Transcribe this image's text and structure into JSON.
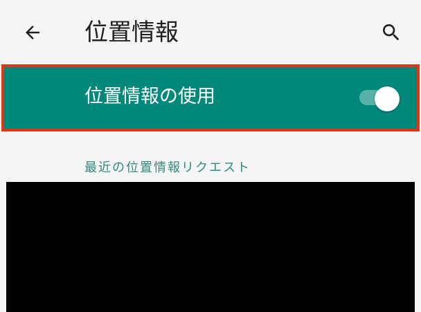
{
  "app_bar": {
    "title": "位置情報",
    "back_icon": "arrow-left-icon",
    "search_icon": "search-icon"
  },
  "main_switch": {
    "label": "位置情報の使用",
    "state": "on",
    "background_color": "#00897b",
    "highlight_color": "#e53415"
  },
  "section": {
    "header": "最近の位置情報リクエスト",
    "header_color": "#2e8b7d"
  }
}
